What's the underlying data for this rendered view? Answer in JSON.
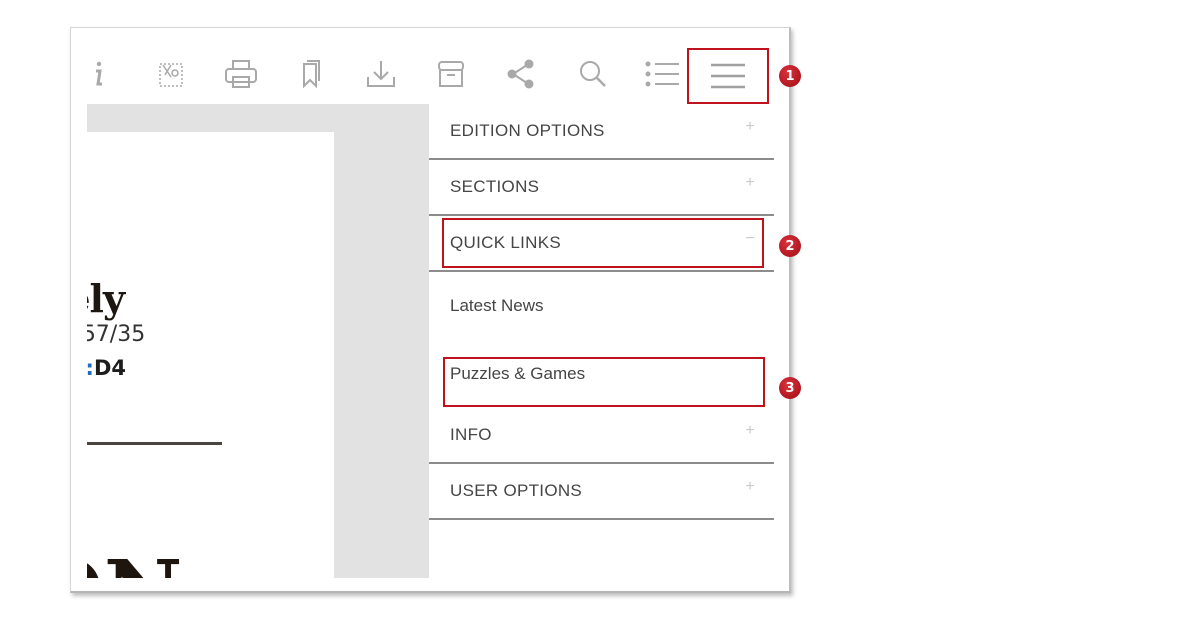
{
  "toolbar": {
    "icons": [
      {
        "name": "info-icon"
      },
      {
        "name": "clip-icon"
      },
      {
        "name": "print-icon"
      },
      {
        "name": "bookmark-icon"
      },
      {
        "name": "download-icon"
      },
      {
        "name": "archive-icon"
      },
      {
        "name": "share-icon"
      },
      {
        "name": "search-icon"
      },
      {
        "name": "list-icon"
      },
      {
        "name": "hamburger-menu-icon"
      }
    ]
  },
  "page_preview": {
    "headline_fragment": "kely",
    "weather_prefix": ":",
    "weather_value": "57/35",
    "forecast_prefix": "AST:",
    "forecast_value": "D4",
    "masthead_fragment": "ON"
  },
  "menu": {
    "sections": [
      {
        "label": "EDITION OPTIONS",
        "toggle": "+"
      },
      {
        "label": "SECTIONS",
        "toggle": "+"
      },
      {
        "label": "QUICK LINKS",
        "toggle": "−"
      }
    ],
    "quick_links": [
      {
        "label": "Latest News"
      },
      {
        "label": "Puzzles & Games"
      }
    ],
    "more_sections": [
      {
        "label": "INFO",
        "toggle": "+"
      },
      {
        "label": "USER OPTIONS",
        "toggle": "+"
      }
    ]
  },
  "annotations": {
    "badges": [
      "1",
      "2",
      "3"
    ],
    "highlight_color": "#c0121c"
  }
}
